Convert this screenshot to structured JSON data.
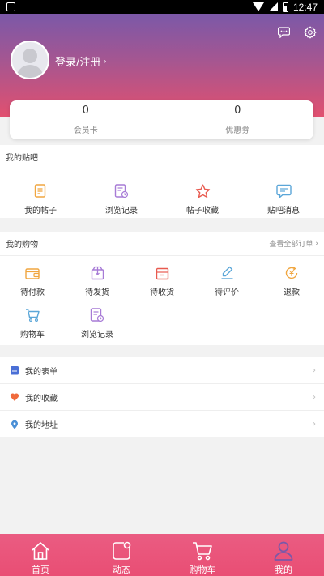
{
  "status_bar": {
    "time": "12:47"
  },
  "profile": {
    "login_label": "登录/注册",
    "login_chevron": "›"
  },
  "stats": [
    {
      "value": "0",
      "label": "会员卡"
    },
    {
      "value": "0",
      "label": "优惠劵"
    }
  ],
  "tieba": {
    "title": "我的贴吧",
    "items": [
      {
        "label": "我的帖子",
        "icon": "document-icon"
      },
      {
        "label": "浏览记录",
        "icon": "history-icon"
      },
      {
        "label": "帖子收藏",
        "icon": "star-icon"
      },
      {
        "label": "贴吧消息",
        "icon": "message-icon"
      }
    ]
  },
  "shopping": {
    "title": "我的购物",
    "more": "查看全部订单",
    "more_chevron": "›",
    "items": [
      {
        "label": "待付款",
        "icon": "wallet-icon"
      },
      {
        "label": "待发货",
        "icon": "box-icon"
      },
      {
        "label": "待收货",
        "icon": "inbox-icon"
      },
      {
        "label": "待评价",
        "icon": "pen-icon"
      },
      {
        "label": "退款",
        "icon": "refund-icon"
      },
      {
        "label": "购物车",
        "icon": "cart-icon"
      },
      {
        "label": "浏览记录",
        "icon": "history-icon"
      }
    ]
  },
  "menu": [
    {
      "label": "我的表单",
      "icon": "form-icon",
      "chevron": "›"
    },
    {
      "label": "我的收藏",
      "icon": "heart-icon",
      "chevron": "›"
    },
    {
      "label": "我的地址",
      "icon": "location-icon",
      "chevron": "›"
    }
  ],
  "tabbar": [
    {
      "label": "首页",
      "icon": "home-icon"
    },
    {
      "label": "动态",
      "icon": "activity-icon"
    },
    {
      "label": "购物车",
      "icon": "cart-icon"
    },
    {
      "label": "我的",
      "icon": "user-icon"
    }
  ],
  "colors": {
    "header_top": "#7b58a8",
    "header_bottom": "#e2506f",
    "tabbar": "#ea5c82",
    "accent_orange": "#f0a640",
    "accent_purple": "#a77bd6",
    "accent_red": "#e85a4f",
    "accent_blue": "#5aa6d8"
  }
}
